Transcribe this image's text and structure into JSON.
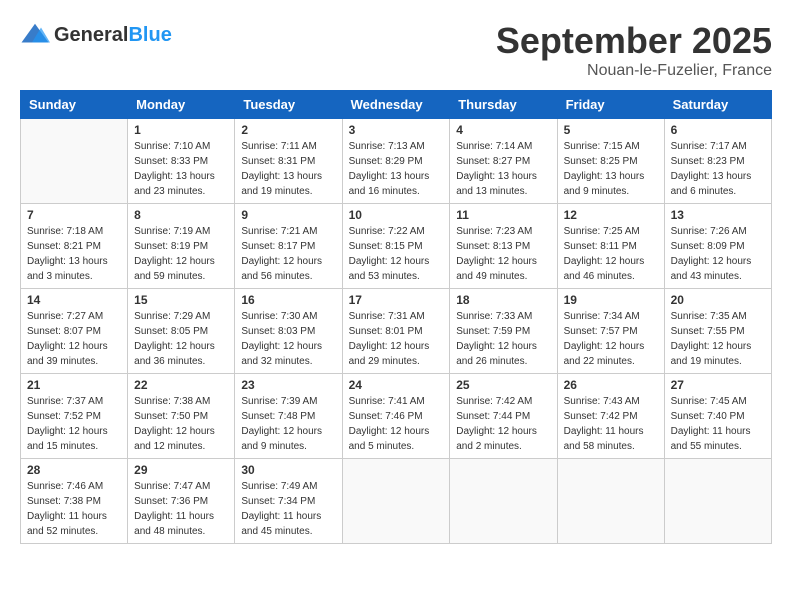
{
  "header": {
    "logo_general": "General",
    "logo_blue": "Blue",
    "title": "September 2025",
    "location": "Nouan-le-Fuzelier, France"
  },
  "calendar": {
    "days_of_week": [
      "Sunday",
      "Monday",
      "Tuesday",
      "Wednesday",
      "Thursday",
      "Friday",
      "Saturday"
    ],
    "weeks": [
      [
        {
          "day": "",
          "sunrise": "",
          "sunset": "",
          "daylight": ""
        },
        {
          "day": "1",
          "sunrise": "Sunrise: 7:10 AM",
          "sunset": "Sunset: 8:33 PM",
          "daylight": "Daylight: 13 hours and 23 minutes."
        },
        {
          "day": "2",
          "sunrise": "Sunrise: 7:11 AM",
          "sunset": "Sunset: 8:31 PM",
          "daylight": "Daylight: 13 hours and 19 minutes."
        },
        {
          "day": "3",
          "sunrise": "Sunrise: 7:13 AM",
          "sunset": "Sunset: 8:29 PM",
          "daylight": "Daylight: 13 hours and 16 minutes."
        },
        {
          "day": "4",
          "sunrise": "Sunrise: 7:14 AM",
          "sunset": "Sunset: 8:27 PM",
          "daylight": "Daylight: 13 hours and 13 minutes."
        },
        {
          "day": "5",
          "sunrise": "Sunrise: 7:15 AM",
          "sunset": "Sunset: 8:25 PM",
          "daylight": "Daylight: 13 hours and 9 minutes."
        },
        {
          "day": "6",
          "sunrise": "Sunrise: 7:17 AM",
          "sunset": "Sunset: 8:23 PM",
          "daylight": "Daylight: 13 hours and 6 minutes."
        }
      ],
      [
        {
          "day": "7",
          "sunrise": "Sunrise: 7:18 AM",
          "sunset": "Sunset: 8:21 PM",
          "daylight": "Daylight: 13 hours and 3 minutes."
        },
        {
          "day": "8",
          "sunrise": "Sunrise: 7:19 AM",
          "sunset": "Sunset: 8:19 PM",
          "daylight": "Daylight: 12 hours and 59 minutes."
        },
        {
          "day": "9",
          "sunrise": "Sunrise: 7:21 AM",
          "sunset": "Sunset: 8:17 PM",
          "daylight": "Daylight: 12 hours and 56 minutes."
        },
        {
          "day": "10",
          "sunrise": "Sunrise: 7:22 AM",
          "sunset": "Sunset: 8:15 PM",
          "daylight": "Daylight: 12 hours and 53 minutes."
        },
        {
          "day": "11",
          "sunrise": "Sunrise: 7:23 AM",
          "sunset": "Sunset: 8:13 PM",
          "daylight": "Daylight: 12 hours and 49 minutes."
        },
        {
          "day": "12",
          "sunrise": "Sunrise: 7:25 AM",
          "sunset": "Sunset: 8:11 PM",
          "daylight": "Daylight: 12 hours and 46 minutes."
        },
        {
          "day": "13",
          "sunrise": "Sunrise: 7:26 AM",
          "sunset": "Sunset: 8:09 PM",
          "daylight": "Daylight: 12 hours and 43 minutes."
        }
      ],
      [
        {
          "day": "14",
          "sunrise": "Sunrise: 7:27 AM",
          "sunset": "Sunset: 8:07 PM",
          "daylight": "Daylight: 12 hours and 39 minutes."
        },
        {
          "day": "15",
          "sunrise": "Sunrise: 7:29 AM",
          "sunset": "Sunset: 8:05 PM",
          "daylight": "Daylight: 12 hours and 36 minutes."
        },
        {
          "day": "16",
          "sunrise": "Sunrise: 7:30 AM",
          "sunset": "Sunset: 8:03 PM",
          "daylight": "Daylight: 12 hours and 32 minutes."
        },
        {
          "day": "17",
          "sunrise": "Sunrise: 7:31 AM",
          "sunset": "Sunset: 8:01 PM",
          "daylight": "Daylight: 12 hours and 29 minutes."
        },
        {
          "day": "18",
          "sunrise": "Sunrise: 7:33 AM",
          "sunset": "Sunset: 7:59 PM",
          "daylight": "Daylight: 12 hours and 26 minutes."
        },
        {
          "day": "19",
          "sunrise": "Sunrise: 7:34 AM",
          "sunset": "Sunset: 7:57 PM",
          "daylight": "Daylight: 12 hours and 22 minutes."
        },
        {
          "day": "20",
          "sunrise": "Sunrise: 7:35 AM",
          "sunset": "Sunset: 7:55 PM",
          "daylight": "Daylight: 12 hours and 19 minutes."
        }
      ],
      [
        {
          "day": "21",
          "sunrise": "Sunrise: 7:37 AM",
          "sunset": "Sunset: 7:52 PM",
          "daylight": "Daylight: 12 hours and 15 minutes."
        },
        {
          "day": "22",
          "sunrise": "Sunrise: 7:38 AM",
          "sunset": "Sunset: 7:50 PM",
          "daylight": "Daylight: 12 hours and 12 minutes."
        },
        {
          "day": "23",
          "sunrise": "Sunrise: 7:39 AM",
          "sunset": "Sunset: 7:48 PM",
          "daylight": "Daylight: 12 hours and 9 minutes."
        },
        {
          "day": "24",
          "sunrise": "Sunrise: 7:41 AM",
          "sunset": "Sunset: 7:46 PM",
          "daylight": "Daylight: 12 hours and 5 minutes."
        },
        {
          "day": "25",
          "sunrise": "Sunrise: 7:42 AM",
          "sunset": "Sunset: 7:44 PM",
          "daylight": "Daylight: 12 hours and 2 minutes."
        },
        {
          "day": "26",
          "sunrise": "Sunrise: 7:43 AM",
          "sunset": "Sunset: 7:42 PM",
          "daylight": "Daylight: 11 hours and 58 minutes."
        },
        {
          "day": "27",
          "sunrise": "Sunrise: 7:45 AM",
          "sunset": "Sunset: 7:40 PM",
          "daylight": "Daylight: 11 hours and 55 minutes."
        }
      ],
      [
        {
          "day": "28",
          "sunrise": "Sunrise: 7:46 AM",
          "sunset": "Sunset: 7:38 PM",
          "daylight": "Daylight: 11 hours and 52 minutes."
        },
        {
          "day": "29",
          "sunrise": "Sunrise: 7:47 AM",
          "sunset": "Sunset: 7:36 PM",
          "daylight": "Daylight: 11 hours and 48 minutes."
        },
        {
          "day": "30",
          "sunrise": "Sunrise: 7:49 AM",
          "sunset": "Sunset: 7:34 PM",
          "daylight": "Daylight: 11 hours and 45 minutes."
        },
        {
          "day": "",
          "sunrise": "",
          "sunset": "",
          "daylight": ""
        },
        {
          "day": "",
          "sunrise": "",
          "sunset": "",
          "daylight": ""
        },
        {
          "day": "",
          "sunrise": "",
          "sunset": "",
          "daylight": ""
        },
        {
          "day": "",
          "sunrise": "",
          "sunset": "",
          "daylight": ""
        }
      ]
    ]
  }
}
